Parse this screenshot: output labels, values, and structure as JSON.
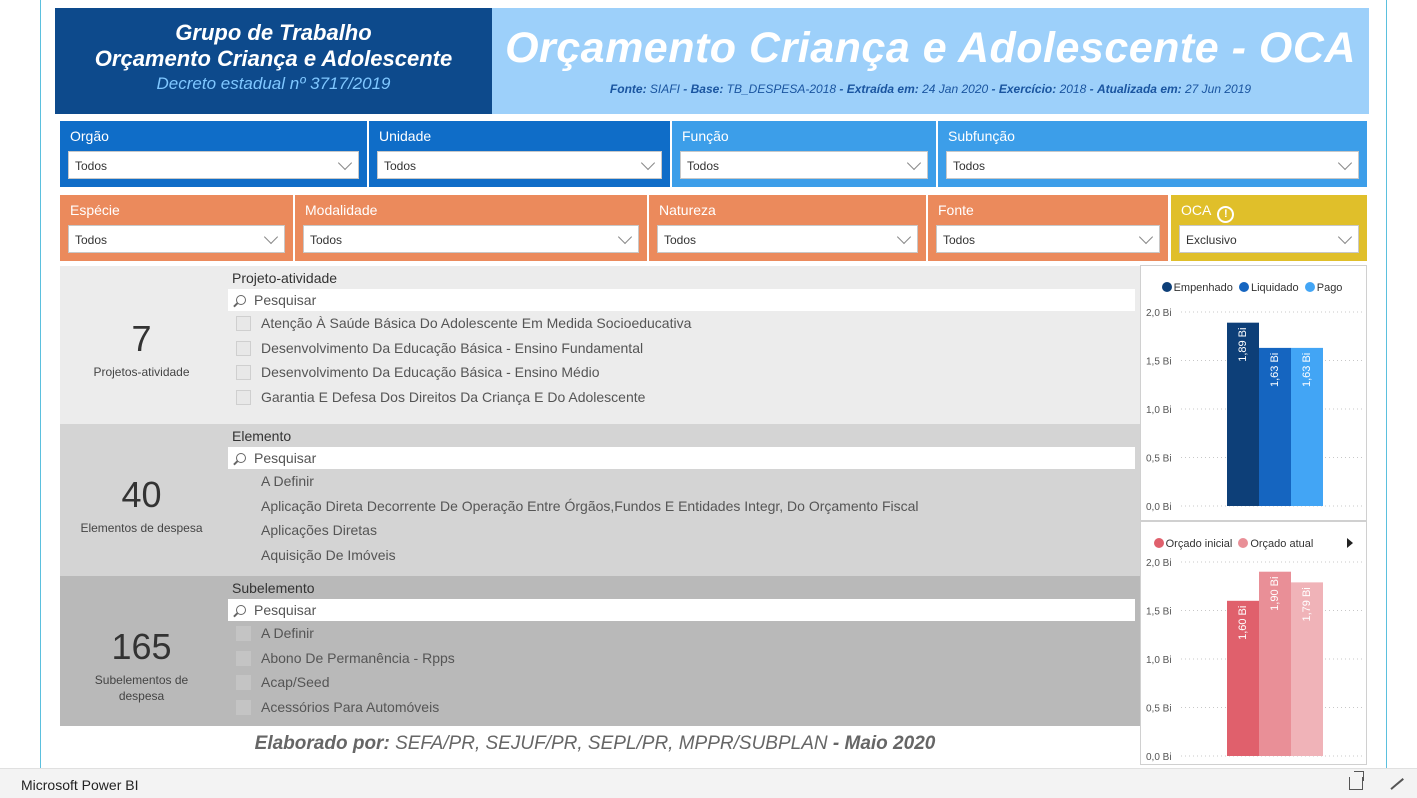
{
  "header": {
    "left_line1": "Grupo de Trabalho",
    "left_line2": "Orçamento Criança e Adolescente",
    "left_line3": "Decreto estadual nº 3717/2019",
    "title": "Orçamento Criança e Adolescente - OCA",
    "source": {
      "fonte_label": "Fonte:",
      "fonte_value": "SIAFI",
      "base_label": "Base:",
      "base_value": "TB_DESPESA-2018",
      "extraida_label": "Extraída em:",
      "extraida_value": "24 Jan 2020",
      "exercicio_label": "Exercício:",
      "exercicio_value": "2018",
      "atualizada_label": "Atualizada em:",
      "atualizada_value": "27 Jun 2019",
      "sep": "-"
    }
  },
  "filters_row1": [
    {
      "label": "Orgão",
      "value": "Todos",
      "color": "#0f6dc8"
    },
    {
      "label": "Unidade",
      "value": "Todos",
      "color": "#0f6dc8"
    },
    {
      "label": "Função",
      "value": "Todos",
      "color": "#3c9ee9"
    },
    {
      "label": "Subfunção",
      "value": "Todos",
      "color": "#3c9ee9"
    }
  ],
  "filters_row2": [
    {
      "label": "Espécie",
      "value": "Todos",
      "color": "#eb8a5c"
    },
    {
      "label": "Modalidade",
      "value": "Todos",
      "color": "#eb8a5c"
    },
    {
      "label": "Natureza",
      "value": "Todos",
      "color": "#eb8a5c"
    },
    {
      "label": "Fonte",
      "value": "Todos",
      "color": "#eb8a5c"
    },
    {
      "label": "OCA",
      "value": "Exclusivo",
      "color": "#e0bf2a",
      "icon": "info-icon"
    }
  ],
  "panels": {
    "projeto": {
      "count": "7",
      "caption": "Projetos-atividade",
      "title": "Projeto-atividade",
      "search_placeholder": "Pesquisar",
      "items": [
        "Atenção À Saúde Básica Do Adolescente Em Medida Socioeducativa",
        "Desenvolvimento Da Educação Básica - Ensino Fundamental",
        "Desenvolvimento Da Educação Básica - Ensino Médio",
        "Garantia E Defesa Dos Direitos Da Criança E Do Adolescente"
      ]
    },
    "elemento": {
      "count": "40",
      "caption": "Elementos de despesa",
      "title": "Elemento",
      "search_placeholder": "Pesquisar",
      "items": [
        "A Definir",
        "Aplicação Direta Decorrente De Operação Entre Órgãos,Fundos E Entidades Integr, Do Orçamento Fiscal",
        "Aplicações Diretas",
        "Aquisição De Imóveis"
      ]
    },
    "subelemento": {
      "count": "165",
      "caption_line1": "Subelementos de",
      "caption_line2": "despesa",
      "title": "Subelemento",
      "search_placeholder": "Pesquisar",
      "items": [
        "A Definir",
        "Abono De Permanência - Rpps",
        "Acap/Seed",
        "Acessórios Para Automóveis"
      ]
    }
  },
  "footer": {
    "label": "Elaborado por:",
    "orgs": "SEFA/PR, SEJUF/PR, SEPL/PR, MPPR/SUBPLAN",
    "sep": "-",
    "date": "Maio 2020"
  },
  "chart_data": [
    {
      "type": "bar",
      "series": [
        {
          "name": "Empenhado",
          "values": [
            1.89
          ],
          "label": "1,89 Bi",
          "color": "#0d3f78"
        },
        {
          "name": "Liquidado",
          "values": [
            1.63
          ],
          "label": "1,63 Bi",
          "color": "#1565c0"
        },
        {
          "name": "Pago",
          "values": [
            1.63
          ],
          "label": "1,63 Bi",
          "color": "#42a5f5"
        }
      ],
      "ylim": [
        0,
        2.0
      ],
      "yticks": [
        "0,0 Bi",
        "0,5 Bi",
        "1,0 Bi",
        "1,5 Bi",
        "2,0 Bi"
      ],
      "grid": true,
      "legend": "top"
    },
    {
      "type": "bar",
      "series": [
        {
          "name": "Orçado inicial",
          "values": [
            1.6
          ],
          "label": "1,60 Bi",
          "color": "#e0606c"
        },
        {
          "name": "Orçado atual",
          "values": [
            1.9
          ],
          "label": "1,90 Bi",
          "color": "#e98f97"
        },
        {
          "name": "",
          "values": [
            1.79
          ],
          "label": "1,79 Bi",
          "color": "#f0b3b8"
        }
      ],
      "ylim": [
        0,
        2.0
      ],
      "yticks": [
        "0,0 Bi",
        "0,5 Bi",
        "1,0 Bi",
        "1,5 Bi",
        "2,0 Bi"
      ],
      "grid": true,
      "legend": "top"
    }
  ],
  "statusbar": {
    "brand": "Microsoft Power BI",
    "share_icon": "share-icon",
    "expand_icon": "expand-icon"
  }
}
